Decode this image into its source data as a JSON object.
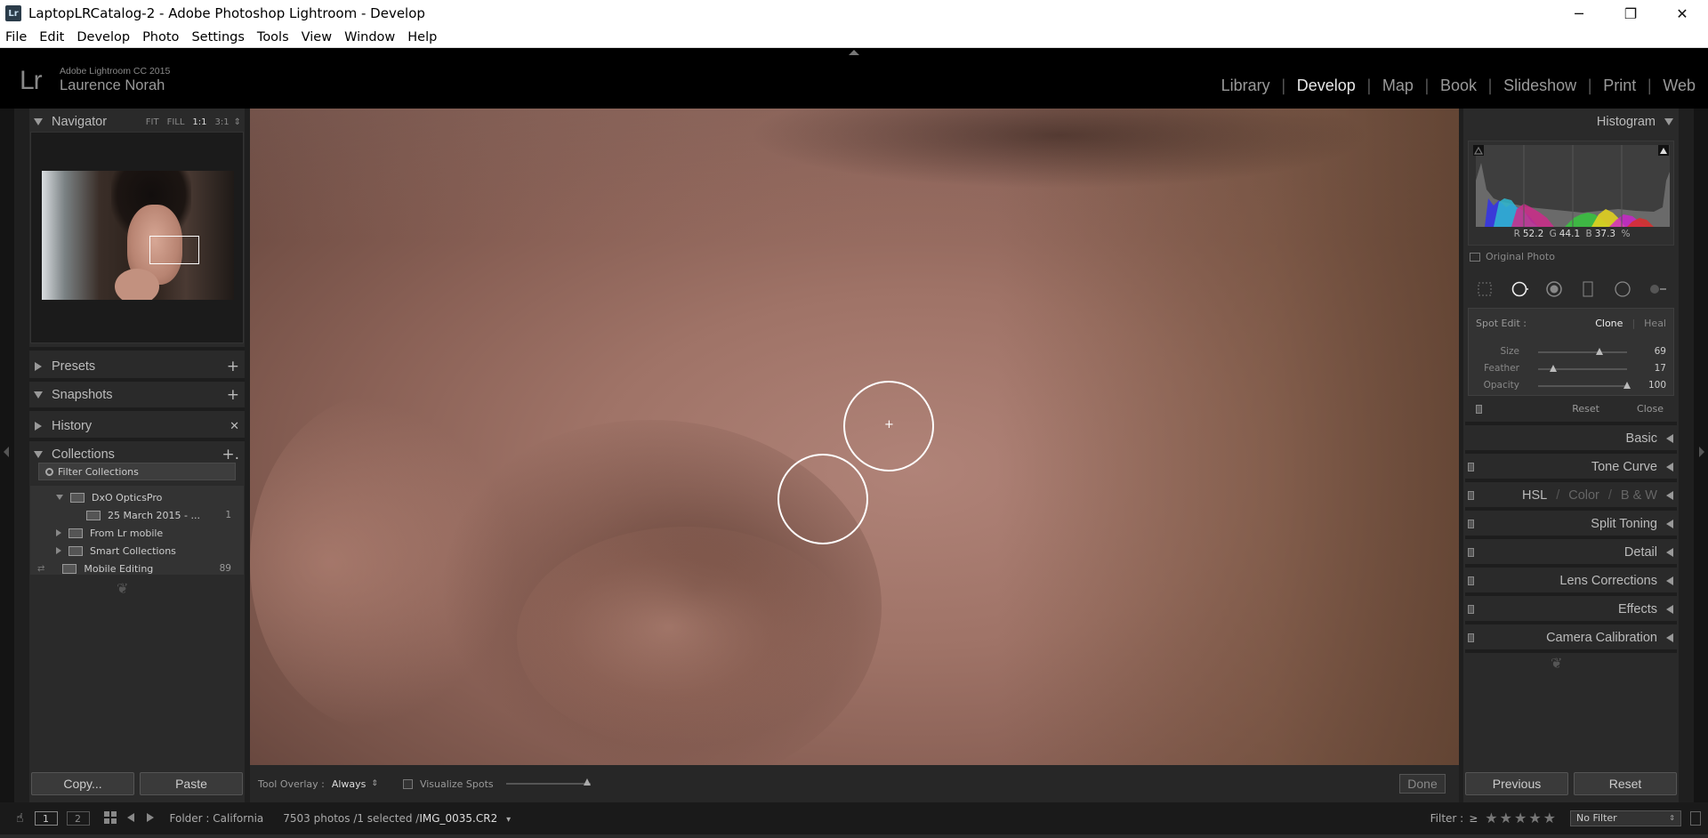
{
  "titlebar": {
    "app_icon": "Lr",
    "title": "LaptopLRCatalog-2 - Adobe Photoshop Lightroom - Develop",
    "minimize": "─",
    "maximize": "❐",
    "close": "✕"
  },
  "menubar": [
    "File",
    "Edit",
    "Develop",
    "Photo",
    "Settings",
    "Tools",
    "View",
    "Window",
    "Help"
  ],
  "header": {
    "logo": "Lr",
    "product": "Adobe Lightroom CC 2015",
    "user": "Laurence Norah",
    "modules": [
      "Library",
      "Develop",
      "Map",
      "Book",
      "Slideshow",
      "Print",
      "Web"
    ],
    "active_module": "Develop"
  },
  "left_panel": {
    "navigator": {
      "title": "Navigator",
      "zoom": [
        "FIT",
        "FILL",
        "1:1",
        "3:1"
      ],
      "active_zoom": "1:1",
      "stepper": "⇕"
    },
    "presets": {
      "title": "Presets",
      "action": "+"
    },
    "snapshots": {
      "title": "Snapshots",
      "action": "+"
    },
    "history": {
      "title": "History",
      "action": "✕"
    },
    "collections": {
      "title": "Collections",
      "action": "+.",
      "filter_placeholder": "Filter Collections",
      "items": [
        {
          "label": "DxO OpticsPro",
          "count": ""
        },
        {
          "label": "25 March 2015 - ...",
          "count": "1"
        },
        {
          "label": "From Lr mobile",
          "count": ""
        },
        {
          "label": "Smart Collections",
          "count": ""
        },
        {
          "label": "Mobile Editing",
          "count": "89"
        }
      ],
      "sync_icon": "⇄"
    },
    "ornament": "❦",
    "copy_button": "Copy...",
    "paste_button": "Paste"
  },
  "toolbar": {
    "tool_overlay_label": "Tool Overlay :",
    "tool_overlay_value": "Always",
    "stepper": "⇕",
    "visualize_spots": "Visualize Spots",
    "done": "Done"
  },
  "canvas": {
    "crosshair": "+"
  },
  "right_panel": {
    "histogram": {
      "title": "Histogram",
      "r_label": "R",
      "r_value": "52.2",
      "g_label": "G",
      "g_value": "44.1",
      "b_label": "B",
      "b_value": "37.3",
      "unit": "%",
      "original_photo": "Original Photo"
    },
    "spot_edit": {
      "label": "Spot Edit :",
      "clone": "Clone",
      "heal": "Heal",
      "active_mode": "Clone",
      "sliders": [
        {
          "label": "Size",
          "value": "69",
          "fraction": 0.69
        },
        {
          "label": "Feather",
          "value": "17",
          "fraction": 0.17
        },
        {
          "label": "Opacity",
          "value": "100",
          "fraction": 1.0
        }
      ],
      "reset": "Reset",
      "close": "Close"
    },
    "panels": [
      {
        "title": "Basic"
      },
      {
        "title": "Tone Curve"
      },
      {
        "title": "HSL_GROUP"
      },
      {
        "title": "Split Toning"
      },
      {
        "title": "Detail"
      },
      {
        "title": "Lens Corrections"
      },
      {
        "title": "Effects"
      },
      {
        "title": "Camera Calibration"
      }
    ],
    "hsl_tabs": [
      "HSL",
      "Color",
      "B & W"
    ],
    "ornament": "❦",
    "previous_button": "Previous",
    "reset_button": "Reset"
  },
  "filmstrip": {
    "view1": "1",
    "view2": "2",
    "folder": "Folder : California",
    "photo_count": "7503 photos /1 selected /",
    "filename": "IMG_0035.CR2",
    "filename_arrow": "▾",
    "filter_label": "Filter :",
    "filter_op": "≥",
    "stars": "★★★★★",
    "filter_value": "No Filter",
    "filter_stepper": "⇕"
  },
  "colors": {
    "accent": "#e6e6e6",
    "panel_bg": "#2a2a2a",
    "background": "#1f1f1f"
  }
}
